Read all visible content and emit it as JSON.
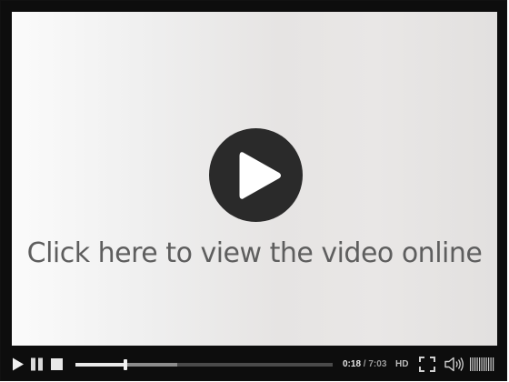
{
  "player": {
    "overlay_text": "Click here to view the video online",
    "progress_fraction": 0.193,
    "buffered_fraction": 0.395,
    "time": {
      "current": "0:18",
      "separator": " / ",
      "duration": "7:03"
    },
    "hd_label": "HD",
    "icons": {
      "big_play": "play-circle-icon",
      "play": "play-icon",
      "pause": "pause-icon",
      "stop": "stop-icon",
      "fullscreen": "fullscreen-icon",
      "volume": "speaker-icon",
      "volume_level": "volume-bars-icon"
    },
    "colors": {
      "frame": "#0d0d0d",
      "play_button": "#2a2a2a",
      "overlay_text": "#5e5e5e"
    }
  }
}
